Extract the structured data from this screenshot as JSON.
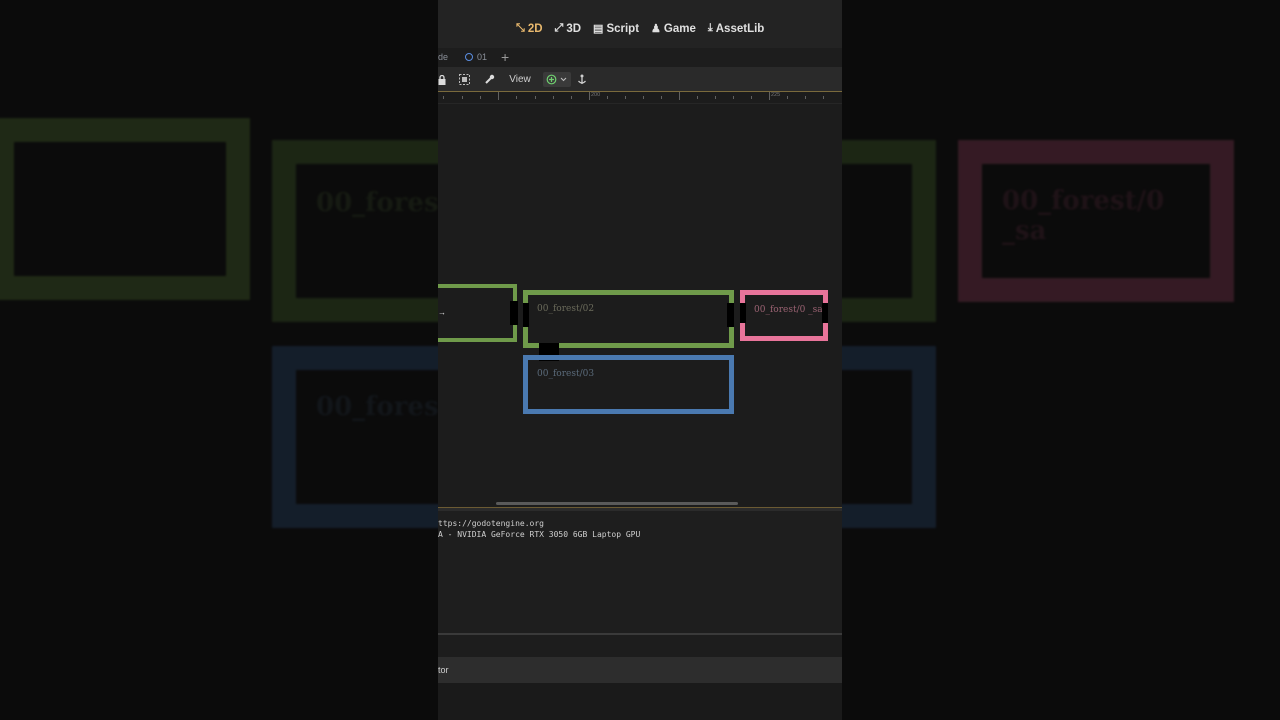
{
  "topbar": {
    "nav": [
      {
        "icon": "2d-icon",
        "glyph": "⤡",
        "label": "2D",
        "active": true
      },
      {
        "icon": "3d-icon",
        "glyph": "⤢",
        "label": "3D",
        "active": false
      },
      {
        "icon": "script-icon",
        "glyph": "▤",
        "label": "Script",
        "active": false
      },
      {
        "icon": "game-icon",
        "glyph": "♟",
        "label": "Game",
        "active": false
      },
      {
        "icon": "assetlib-icon",
        "glyph": "⤓",
        "label": "AssetLib",
        "active": false
      }
    ]
  },
  "tabs": {
    "previous_fragment": "de",
    "current": "01",
    "add": "+"
  },
  "toolbar": {
    "lock_icon": "lock-icon",
    "group_icon": "group-icon",
    "edit_icon": "wrench-icon",
    "view_label": "View",
    "snap_icon": "snap-icon",
    "anchor_icon": "anchor-icon"
  },
  "ruler": {
    "labels": [
      "200",
      "225"
    ]
  },
  "rooms": [
    {
      "id": "left-room",
      "label": "",
      "color": "#6f9a4a"
    },
    {
      "id": "forest-02",
      "label": "00_forest/02",
      "color": "#6f9a4a"
    },
    {
      "id": "forest-0-sa",
      "label": "00_forest/0 _sa",
      "color": "#e8749a"
    },
    {
      "id": "forest-03",
      "label": "00_forest/03",
      "color": "#4a79b0"
    }
  ],
  "background_labels": {
    "left_green": "00_fores",
    "left_blue": "00_fores",
    "right_pink": "00_forest/0 _sa"
  },
  "output": {
    "lines": [
      "ttps://godotengine.org",
      "A - NVIDIA GeForce RTX 3050 6GB Laptop GPU"
    ]
  },
  "bottom_panel": {
    "tab_label": "tor"
  },
  "colors": {
    "accent": "#e8b86d",
    "green_room": "#6f9a4a",
    "pink_room": "#e8749a",
    "blue_room": "#4a79b0"
  }
}
